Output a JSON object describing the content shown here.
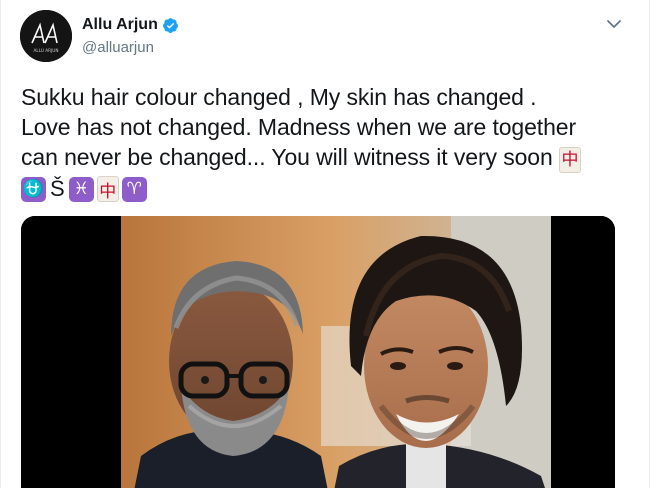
{
  "author": {
    "display_name": "Allu Arjun",
    "handle": "@alluarjun",
    "verified": true,
    "avatar_text": "ALLU ARJUN"
  },
  "tweet": {
    "lines": [
      "Sukku hair colour changed , My skin  has changed .",
      "Love has not changed. Madness when we are together",
      "can never be changed... You will witness it very soon"
    ],
    "emoji_sequence": [
      "mahjong-red-dragon",
      "ophiuchus-sign",
      "Š",
      "pisces-sign",
      "mahjong-red-dragon",
      "aries-sign"
    ],
    "s_char": "Š"
  },
  "icons": {
    "verified": "verified-badge-icon",
    "caret": "chevron-down-icon"
  },
  "colors": {
    "name": "#14171a",
    "handle": "#657786",
    "verified": "#1da1f2",
    "zodiac_tile": "#8e5dc9",
    "mahjong_red": "#c8102e"
  }
}
